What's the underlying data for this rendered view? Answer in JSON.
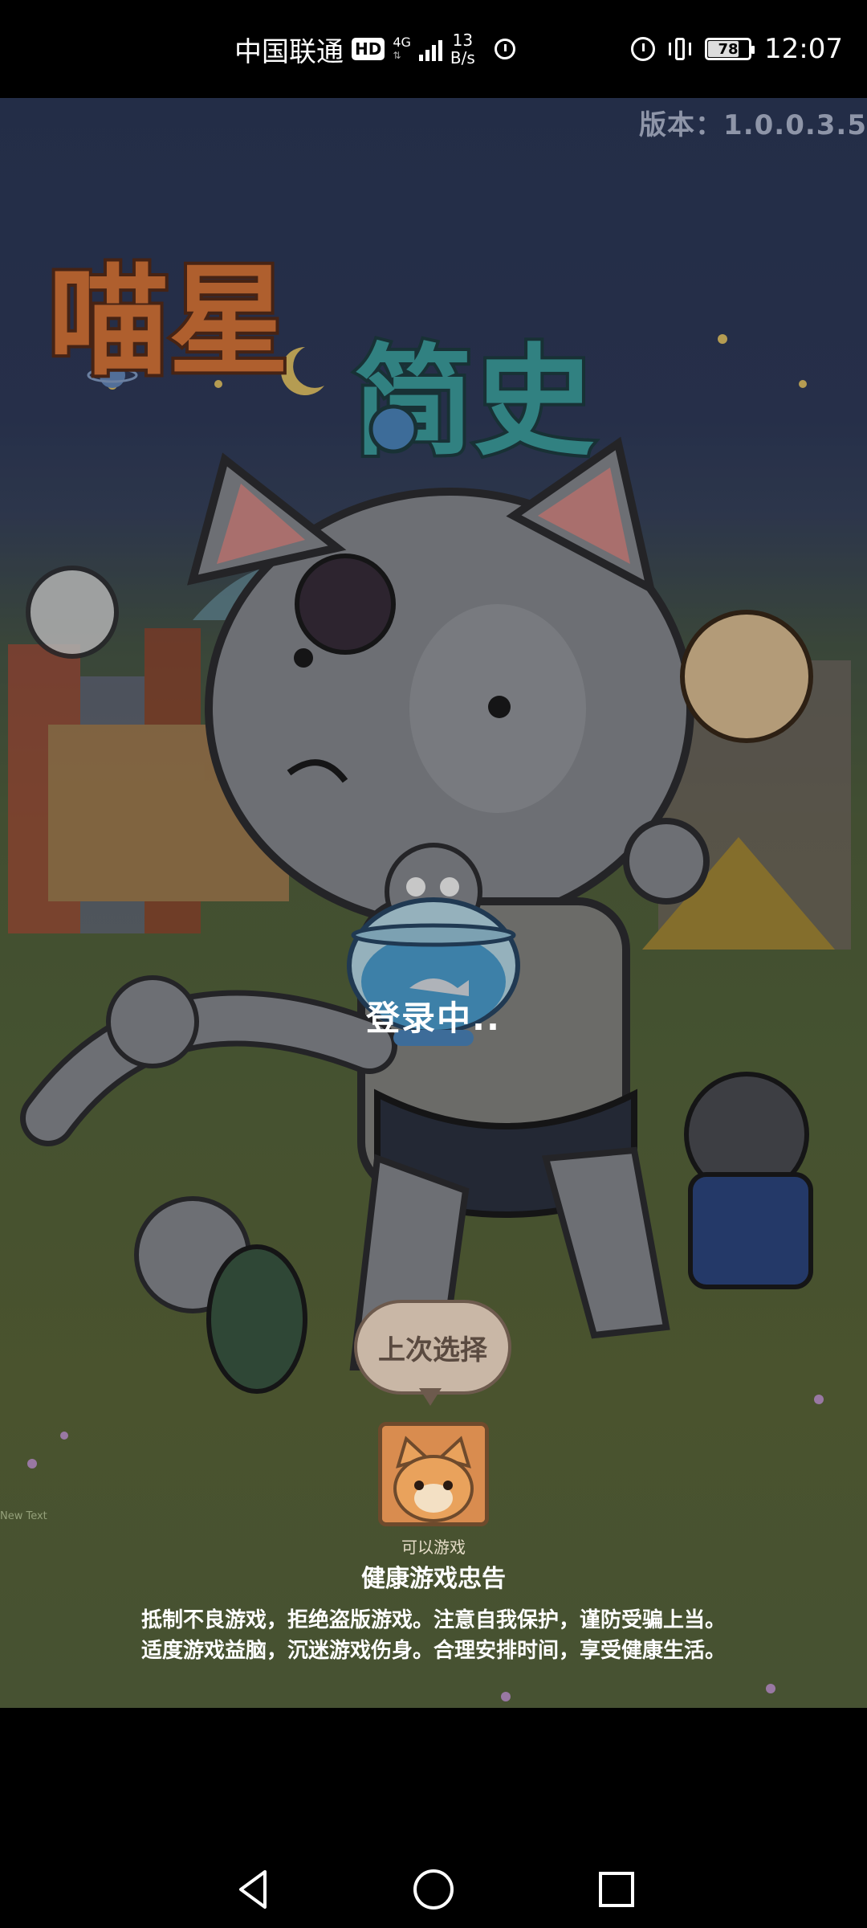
{
  "status_bar": {
    "carrier": "中国联通",
    "hd_badge": "HD",
    "network_type": "4G",
    "speed_value": "13",
    "speed_unit": "B/s",
    "battery_level": "78",
    "time": "12:07"
  },
  "game": {
    "version": "版本：1.0.0.3.5",
    "title_text": "喵星人简史",
    "loading_text": "登录中..",
    "last_choice_label": "上次选择",
    "avatar_caption": "可以游戏",
    "debug_text": "New Text"
  },
  "notice": {
    "title": "健康游戏忠告",
    "line1": "抵制不良游戏，拒绝盗版游戏。注意自我保护，谨防受骗上当。",
    "line2": "适度游戏益脑，沉迷游戏伤身。合理安排时间，享受健康生活。"
  },
  "colors": {
    "sky": "#2e3a5c",
    "grass": "#5b6a40",
    "title_orange": "#e07a3c",
    "title_teal": "#3fa6a6"
  },
  "icons": {
    "back": "triangle-back-icon",
    "home": "circle-home-icon",
    "recent": "square-recent-icon"
  }
}
